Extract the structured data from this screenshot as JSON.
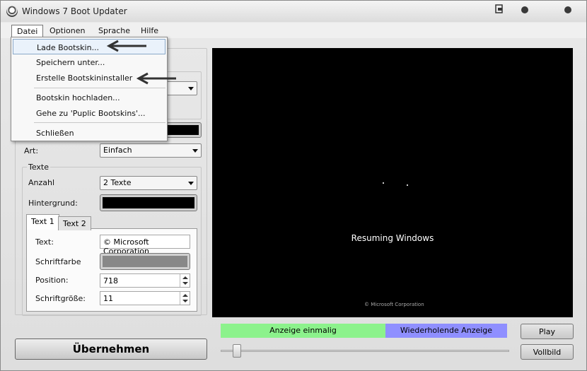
{
  "window": {
    "title": "Windows 7 Boot Updater"
  },
  "menubar": {
    "items": [
      "Datei",
      "Optionen",
      "Sprache",
      "Hilfe"
    ]
  },
  "dropdown": {
    "items": [
      "Lade Bootskin...",
      "Speichern unter...",
      "Erstelle Bootskininstaller",
      "Bootskin hochladen...",
      "Gehe zu 'Puplic Bootskins'...",
      "Schließen"
    ]
  },
  "left": {
    "art_label": "Art:",
    "art_value": "Einfach",
    "texte_group": "Texte",
    "anzahl_label": "Anzahl",
    "anzahl_value": "2 Texte",
    "hintergrund_label": "Hintergrund:",
    "tabs": [
      "Text 1",
      "Text 2"
    ],
    "text_label": "Text:",
    "text_value": "© Microsoft Corporation",
    "schriftfarbe_label": "Schriftfarbe",
    "position_label": "Position:",
    "position_value": "718",
    "schriftgroesse_label": "Schriftgröße:",
    "schriftgroesse_value": "11",
    "apply_button": "Übernehmen"
  },
  "preview": {
    "main_text": "Resuming Windows",
    "copyright_text": "© Microsoft Corporation"
  },
  "controls": {
    "mode_once": "Anzeige einmalig",
    "mode_repeat": "Wiederholende Anzeige",
    "play_button": "Play",
    "fullscreen_button": "Vollbild",
    "slider_position": 0.05
  },
  "colors": {
    "mode_once_bg": "#8cf28c",
    "mode_repeat_bg": "#8f8fff",
    "preview_bg": "#000000",
    "background_color": "#000000",
    "font_color": "#888888"
  }
}
